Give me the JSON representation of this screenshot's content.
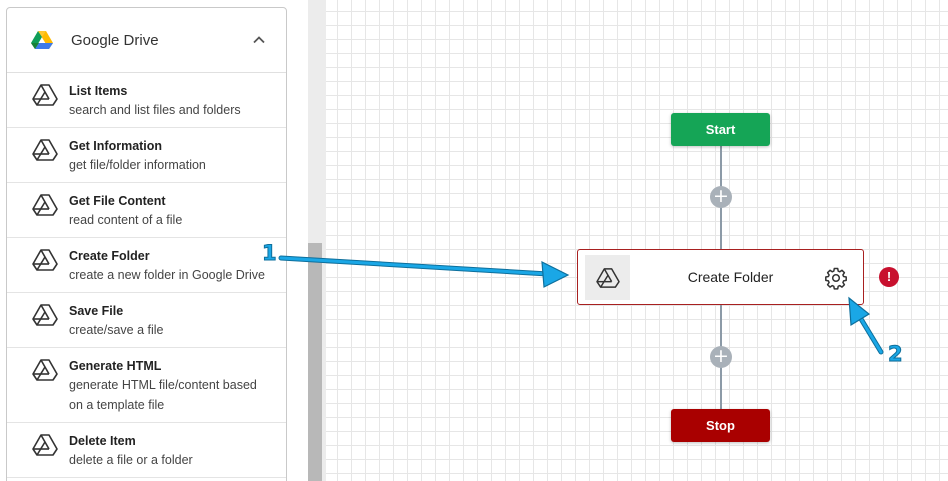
{
  "panel": {
    "title": "Google Drive",
    "items": [
      {
        "name": "List Items",
        "desc": "search and list files and folders"
      },
      {
        "name": "Get Information",
        "desc": "get file/folder information"
      },
      {
        "name": "Get File Content",
        "desc": "read content of a file"
      },
      {
        "name": "Create Folder",
        "desc": "create a new folder in Google Drive"
      },
      {
        "name": "Save File",
        "desc": "create/save a file"
      },
      {
        "name": "Generate HTML",
        "desc": "generate HTML file/content based on a template file"
      },
      {
        "name": "Delete Item",
        "desc": "delete a file or a folder"
      }
    ]
  },
  "flow": {
    "start_label": "Start",
    "task_label": "Create Folder",
    "stop_label": "Stop",
    "plus": "+",
    "error": "!"
  },
  "annotations": {
    "one": "1",
    "two": "2"
  },
  "colors": {
    "start": "#15a556",
    "stop": "#a90000",
    "error": "#c8102e",
    "arrow": "#1aa7e6"
  }
}
